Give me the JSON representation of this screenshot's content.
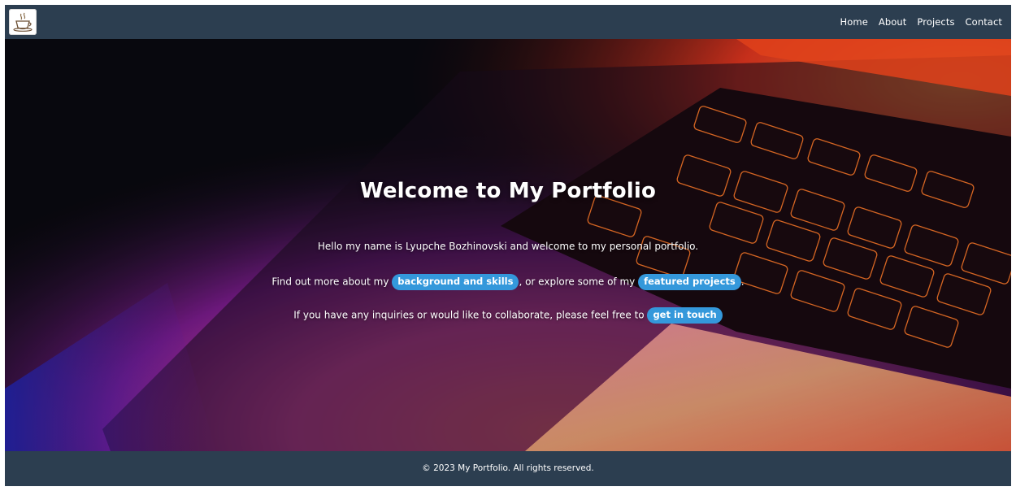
{
  "header": {
    "logo_icon": "coffee-cup-logo-icon",
    "nav": [
      {
        "label": "Home"
      },
      {
        "label": "About"
      },
      {
        "label": "Projects"
      },
      {
        "label": "Contact"
      }
    ]
  },
  "hero": {
    "title": "Welcome to My Portfolio",
    "intro": "Hello my name is Lyupche Bozhinovski and welcome to my personal portfolio.",
    "line2": {
      "before": "Find out more about my ",
      "link1": "background and skills",
      "middle": ", or explore some of my ",
      "link2": "featured projects",
      "after": "."
    },
    "line3": {
      "before": "If you have any inquiries or would like to collaborate, please feel free to ",
      "link": "get in touch"
    },
    "background": "laptop-keyboard-photo"
  },
  "footer": {
    "text": "© 2023 My Portfolio. All rights reserved."
  },
  "colors": {
    "nav_bg": "#2c3e50",
    "accent": "#3498db",
    "text": "#ffffff"
  }
}
